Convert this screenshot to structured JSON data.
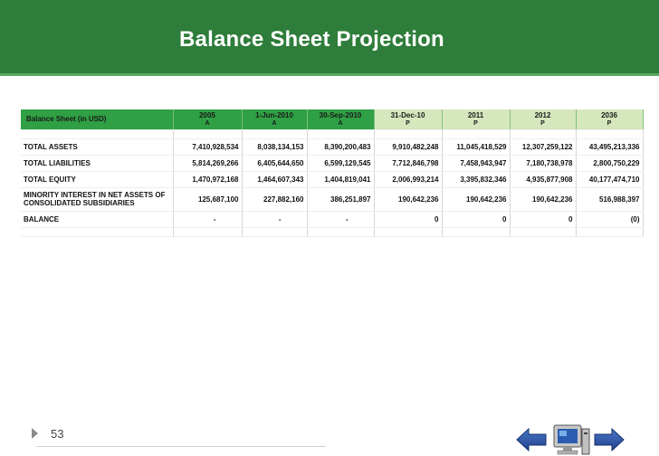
{
  "slide": {
    "title": "Balance Sheet Projection",
    "page_number": "53"
  },
  "table": {
    "header_label": "Balance Sheet (in USD)",
    "columns": [
      {
        "date": "2005",
        "type": "A"
      },
      {
        "date": "1-Jun-2010",
        "type": "A"
      },
      {
        "date": "30-Sep-2010",
        "type": "A"
      },
      {
        "date": "31-Dec-10",
        "type": "P"
      },
      {
        "date": "2011",
        "type": "P"
      },
      {
        "date": "2012",
        "type": "P"
      },
      {
        "date": "2036",
        "type": "P"
      }
    ],
    "rows": [
      {
        "name": "TOTAL ASSETS",
        "values": [
          "7,410,928,534",
          "8,038,134,153",
          "8,390,200,483",
          "9,910,482,248",
          "11,045,418,529",
          "12,307,259,122",
          "43,495,213,336"
        ]
      },
      {
        "name": "TOTAL LIABILITIES",
        "values": [
          "5,814,269,266",
          "6,405,644,650",
          "6,599,129,545",
          "7,712,846,798",
          "7,458,943,947",
          "7,180,738,978",
          "2,800,750,229"
        ]
      },
      {
        "name": "TOTAL EQUITY",
        "values": [
          "1,470,972,168",
          "1,464,607,343",
          "1,404,819,041",
          "2,006,993,214",
          "3,395,832,346",
          "4,935,877,908",
          "40,177,474,710"
        ]
      },
      {
        "name_line1": "MINORITY INTEREST IN NET ASSETS OF",
        "name_line2": "CONSOLIDATED SUBSIDIARIES",
        "values": [
          "125,687,100",
          "227,882,160",
          "386,251,897",
          "190,642,236",
          "190,642,236",
          "190,642,236",
          "516,988,397"
        ]
      },
      {
        "name": "BALANCE",
        "values": [
          "-",
          "-",
          "-",
          "0",
          "0",
          "0",
          "(0)"
        ]
      }
    ]
  },
  "colors": {
    "title_bar": "#2e7d3a",
    "actual_header": "#2fa044",
    "projection_header": "#d7e7bd"
  }
}
